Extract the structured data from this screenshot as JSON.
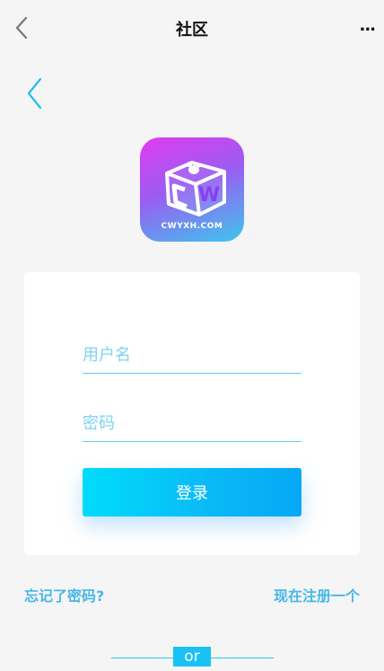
{
  "header": {
    "title": "社区",
    "more": "..."
  },
  "logo": {
    "text": "CWYXH.COM",
    "letter": "W"
  },
  "form": {
    "username_placeholder": "用户名",
    "password_placeholder": "密码",
    "login_label": "登录"
  },
  "links": {
    "forgot": "忘记了密码?",
    "register": "现在注册一个"
  },
  "divider": {
    "label": "or"
  },
  "colors": {
    "accent": "#19c2f6",
    "link": "#46b7ea",
    "background": "#f5f5f5"
  }
}
